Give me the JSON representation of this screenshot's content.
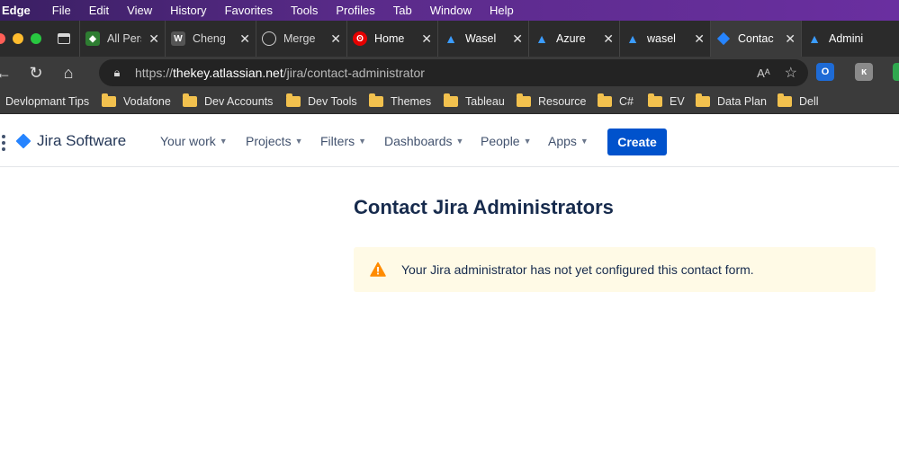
{
  "menubar": {
    "items": [
      "Edge",
      "File",
      "Edit",
      "View",
      "History",
      "Favorites",
      "Tools",
      "Profiles",
      "Tab",
      "Window",
      "Help"
    ]
  },
  "tabs": [
    {
      "title": "All Pers",
      "icon": "leaf-icon",
      "color": "#2e7d32"
    },
    {
      "title": "Cheng",
      "icon": "w-icon",
      "color": "#555555"
    },
    {
      "title": "Merge",
      "icon": "github-icon",
      "color": "#222222"
    },
    {
      "title": "Home",
      "icon": "vodafone-icon",
      "color": "#e60000"
    },
    {
      "title": "Wasel",
      "icon": "azure-icon",
      "color": "#1e88e5"
    },
    {
      "title": "Azure",
      "icon": "azure-icon",
      "color": "#1e88e5"
    },
    {
      "title": "wasel",
      "icon": "azure-icon",
      "color": "#1e88e5"
    },
    {
      "title": "Contac",
      "icon": "jira-icon",
      "color": "#2684ff",
      "active": true
    },
    {
      "title": "Admini",
      "icon": "atlassian-icon",
      "color": "#1e88e5"
    }
  ],
  "address": {
    "scheme": "https://",
    "host": "thekey.atlassian.net",
    "path": "/jira/contact-administrator"
  },
  "bookmarks": [
    {
      "label": "Devlopmant Tips",
      "folder": false
    },
    {
      "label": "Vodafone",
      "folder": true
    },
    {
      "label": "Dev Accounts",
      "folder": true
    },
    {
      "label": "Dev Tools",
      "folder": true
    },
    {
      "label": "Themes",
      "folder": true
    },
    {
      "label": "Tableau",
      "folder": true
    },
    {
      "label": "Resource",
      "folder": true
    },
    {
      "label": "C#",
      "folder": true
    },
    {
      "label": "EV",
      "folder": true
    },
    {
      "label": "Data Plan",
      "folder": true
    },
    {
      "label": "Dell",
      "folder": true
    }
  ],
  "jira": {
    "logo_text": "Jira Software",
    "nav": [
      "Your work",
      "Projects",
      "Filters",
      "Dashboards",
      "People",
      "Apps"
    ],
    "create_label": "Create"
  },
  "content": {
    "title": "Contact Jira Administrators",
    "warning": "Your Jira administrator has not yet configured this contact form.",
    "warning_color": "#ff8b00"
  }
}
